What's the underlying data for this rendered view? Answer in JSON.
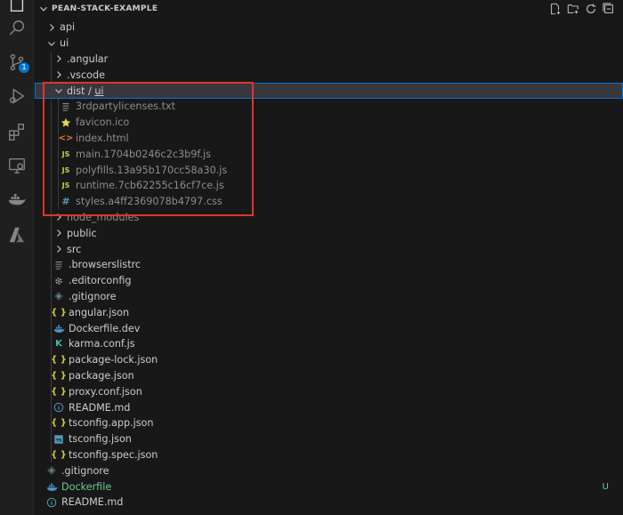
{
  "explorer": {
    "section_title": "PEAN-STACK-EXAMPLE",
    "header_actions": [
      "new-file-icon",
      "new-folder-icon",
      "refresh-icon",
      "collapse-all-icon"
    ]
  },
  "activity_bar": {
    "items": [
      "explorer-icon",
      "search-icon",
      "source-control-icon",
      "run-debug-icon",
      "extensions-icon",
      "remote-explorer-icon",
      "docker-icon",
      "azure-icon"
    ],
    "source_control_badge": "1"
  },
  "tree": [
    {
      "label": "api",
      "type": "folder",
      "expanded": false,
      "depth": 0
    },
    {
      "label": "ui",
      "type": "folder",
      "expanded": true,
      "depth": 0
    },
    {
      "label": ".angular",
      "type": "folder",
      "expanded": false,
      "depth": 1
    },
    {
      "label": ".vscode",
      "type": "folder",
      "expanded": false,
      "depth": 1
    },
    {
      "label": "dist",
      "label2": "ui",
      "type": "folder",
      "expanded": true,
      "depth": 1,
      "selected": true
    },
    {
      "label": "3rdpartylicenses.txt",
      "type": "file",
      "icon": "text-file-icon",
      "depth": 2,
      "dim": true
    },
    {
      "label": "favicon.ico",
      "type": "file",
      "icon": "favicon-star-icon",
      "depth": 2,
      "dim": true
    },
    {
      "label": "index.html",
      "type": "file",
      "icon": "html-file-icon",
      "depth": 2,
      "dim": true
    },
    {
      "label": "main.1704b0246c2c3b9f.js",
      "type": "file",
      "icon": "js-file-icon",
      "depth": 2,
      "dim": true
    },
    {
      "label": "polyfills.13a95b170cc58a30.js",
      "type": "file",
      "icon": "js-file-icon",
      "depth": 2,
      "dim": true
    },
    {
      "label": "runtime.7cb62255c16cf7ce.js",
      "type": "file",
      "icon": "js-file-icon",
      "depth": 2,
      "dim": true
    },
    {
      "label": "styles.a4ff2369078b4797.css",
      "type": "file",
      "icon": "css-file-icon",
      "depth": 2,
      "dim": true
    },
    {
      "label": "node_modules",
      "type": "folder",
      "expanded": false,
      "depth": 1,
      "dim": true
    },
    {
      "label": "public",
      "type": "folder",
      "expanded": false,
      "depth": 1
    },
    {
      "label": "src",
      "type": "folder",
      "expanded": false,
      "depth": 1
    },
    {
      "label": ".browserslistrc",
      "type": "file",
      "icon": "text-file-icon",
      "depth": 1
    },
    {
      "label": ".editorconfig",
      "type": "file",
      "icon": "gear-icon",
      "depth": 1
    },
    {
      "label": ".gitignore",
      "type": "file",
      "icon": "git-icon",
      "depth": 1
    },
    {
      "label": "angular.json",
      "type": "file",
      "icon": "json-file-icon",
      "depth": 1
    },
    {
      "label": "Dockerfile.dev",
      "type": "file",
      "icon": "docker-file-icon",
      "depth": 1
    },
    {
      "label": "karma.conf.js",
      "type": "file",
      "icon": "karma-file-icon",
      "depth": 1
    },
    {
      "label": "package-lock.json",
      "type": "file",
      "icon": "json-file-icon",
      "depth": 1
    },
    {
      "label": "package.json",
      "type": "file",
      "icon": "json-file-icon",
      "depth": 1
    },
    {
      "label": "proxy.conf.json",
      "type": "file",
      "icon": "json-file-icon",
      "depth": 1
    },
    {
      "label": "README.md",
      "type": "file",
      "icon": "info-icon",
      "depth": 1
    },
    {
      "label": "tsconfig.app.json",
      "type": "file",
      "icon": "json-file-icon",
      "depth": 1
    },
    {
      "label": "tsconfig.json",
      "type": "file",
      "icon": "ts-config-icon",
      "depth": 1
    },
    {
      "label": "tsconfig.spec.json",
      "type": "file",
      "icon": "json-file-icon",
      "depth": 1
    },
    {
      "label": ".gitignore",
      "type": "file",
      "icon": "git-icon",
      "depth": 0
    },
    {
      "label": "Dockerfile",
      "type": "file",
      "icon": "docker-file-icon",
      "depth": 0,
      "git_status": "U",
      "untracked": true
    },
    {
      "label": "README.md",
      "type": "file",
      "icon": "info-icon",
      "depth": 0
    }
  ],
  "colors": {
    "highlight_box": "#e0342a",
    "selection_outline": "#0078d4",
    "untracked": "#73c991",
    "json_icon": "#cbcb41",
    "js_icon": "#cbcb41",
    "css_icon": "#519aba",
    "html_icon": "#e37933",
    "docker_icon": "#4e94ce"
  }
}
